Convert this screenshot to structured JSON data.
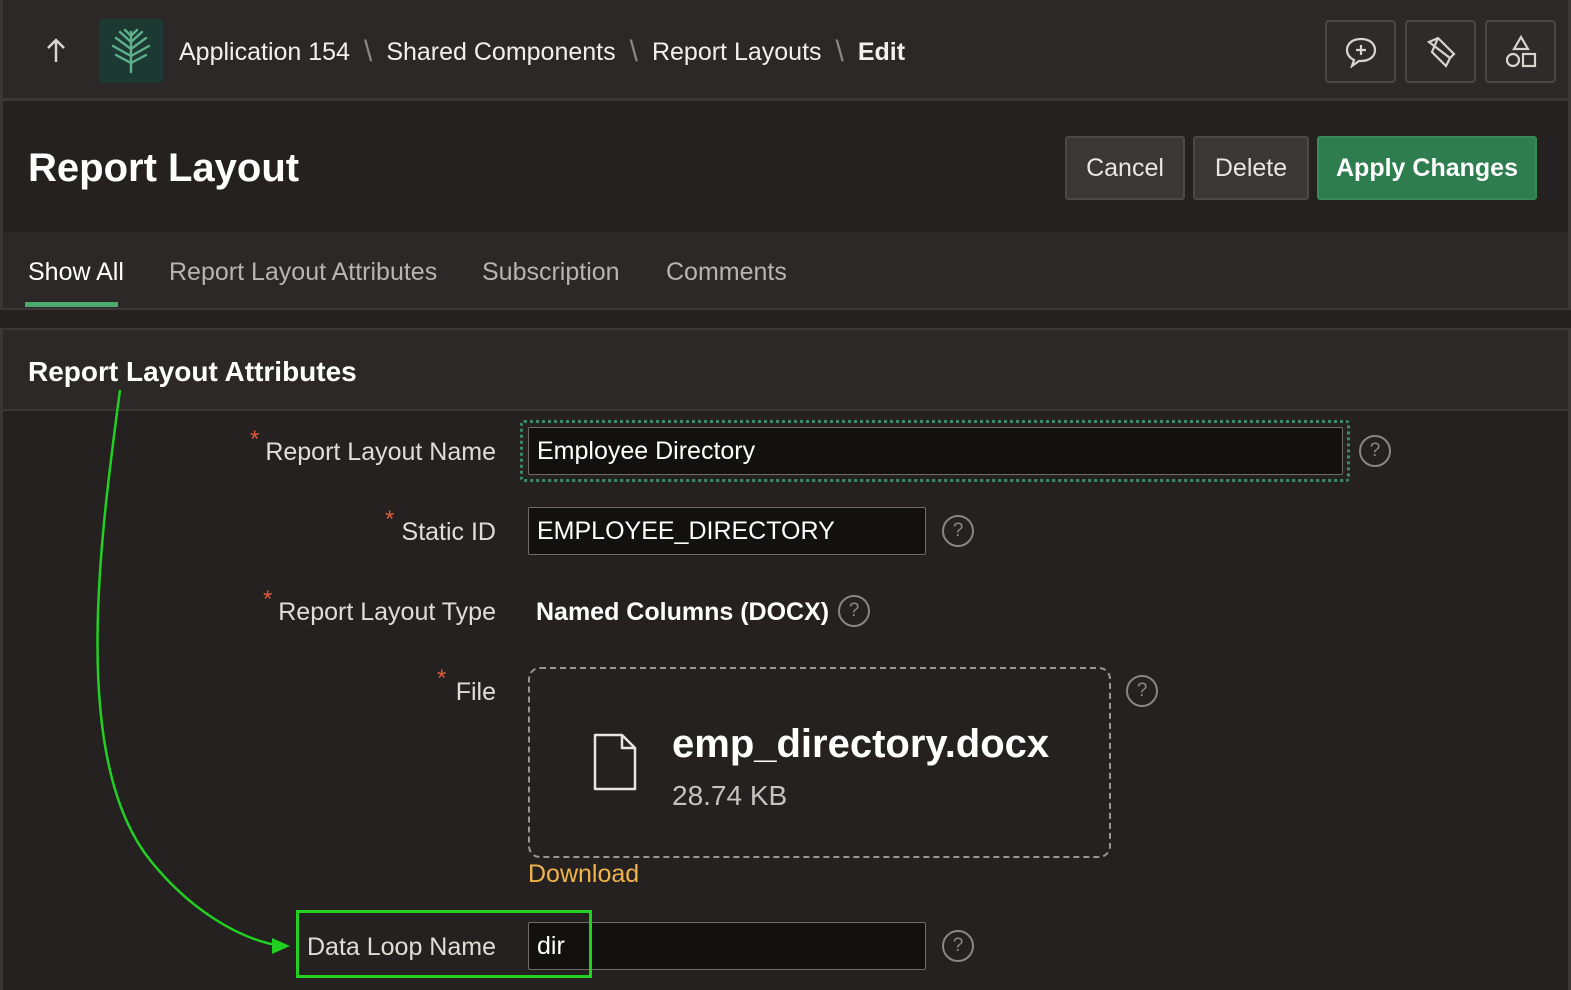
{
  "topbar": {
    "breadcrumb": {
      "app": "Application 154",
      "shared": "Shared Components",
      "layouts": "Report Layouts",
      "current": "Edit"
    },
    "icons": [
      "navigate-up-icon",
      "app-logo-icon",
      "feedback-icon",
      "developer-tools-icon",
      "shapes-icon"
    ]
  },
  "header": {
    "title": "Report Layout",
    "cancel_label": "Cancel",
    "delete_label": "Delete",
    "apply_label": "Apply Changes"
  },
  "tabs": [
    {
      "label": "Show All",
      "active": true
    },
    {
      "label": "Report Layout Attributes",
      "active": false
    },
    {
      "label": "Subscription",
      "active": false
    },
    {
      "label": "Comments",
      "active": false
    }
  ],
  "region": {
    "title": "Report Layout Attributes",
    "fields": {
      "name": {
        "label": "Report Layout Name",
        "value": "Employee Directory",
        "required": true
      },
      "static_id": {
        "label": "Static ID",
        "value": "EMPLOYEE_DIRECTORY",
        "required": true
      },
      "type": {
        "label": "Report Layout Type",
        "value": "Named Columns (DOCX)",
        "required": true
      },
      "file": {
        "label": "File",
        "file_name": "emp_directory.docx",
        "file_size": "28.74 KB",
        "download_label": "Download",
        "required": true
      },
      "data_loop": {
        "label": "Data Loop Name",
        "value": "dir",
        "required": false
      }
    }
  },
  "colors": {
    "accent_green": "#2e7d4f",
    "tab_underline": "#4caa6e",
    "required_star": "#e05a3a",
    "link": "#f0b44c",
    "annotation": "#22d022"
  }
}
